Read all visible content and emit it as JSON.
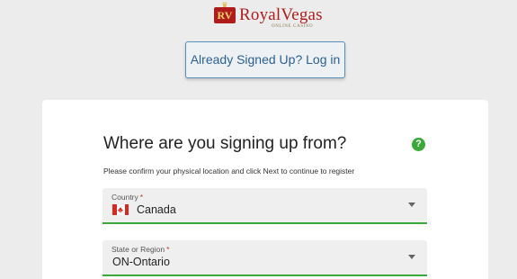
{
  "logo": {
    "badge": "RV",
    "name": "RoyalVegas",
    "tagline": "ONLINE CASINO"
  },
  "login_button": {
    "label": "Already Signed Up? Log in"
  },
  "form": {
    "heading": "Where are you signing up from?",
    "help_icon": "?",
    "instruction": "Please confirm your physical location and click Next to continue to register",
    "country": {
      "label": "Country",
      "required_mark": "*",
      "value": "Canada",
      "flag_icon": "canada-flag"
    },
    "region": {
      "label": "State or Region",
      "required_mark": "*",
      "value": "ON-Ontario"
    }
  },
  "colors": {
    "brand_red": "#b01c1c",
    "accent_green": "#3aa83a",
    "link_blue": "#2a5f94"
  }
}
